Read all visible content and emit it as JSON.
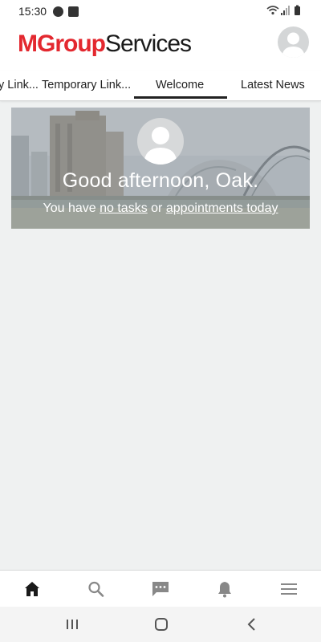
{
  "status_bar": {
    "time": "15:30",
    "icons": [
      "app-notification-icon",
      "app-notification-icon",
      "wifi-icon",
      "signal-icon",
      "battery-icon"
    ]
  },
  "header": {
    "logo_part1": "MGroup",
    "logo_part2": "Services",
    "brand_color": "#e3282f"
  },
  "tabs": [
    {
      "label": "y Link..."
    },
    {
      "label": "Temporary Link..."
    },
    {
      "label": "Welcome",
      "selected": true
    },
    {
      "label": "Latest News"
    }
  ],
  "welcome": {
    "greeting": "Good afternoon, Oak.",
    "prefix": "You have ",
    "tasks_link": "no tasks",
    "connector": " or ",
    "appointments_link": "appointments today"
  },
  "bottom_nav": {
    "items": [
      {
        "icon": "home-icon",
        "active": true
      },
      {
        "icon": "search-icon"
      },
      {
        "icon": "chat-icon"
      },
      {
        "icon": "bell-icon"
      },
      {
        "icon": "menu-icon"
      }
    ]
  },
  "system_nav": {
    "items": [
      "recent-apps-icon",
      "home-circle-icon",
      "back-icon"
    ]
  }
}
